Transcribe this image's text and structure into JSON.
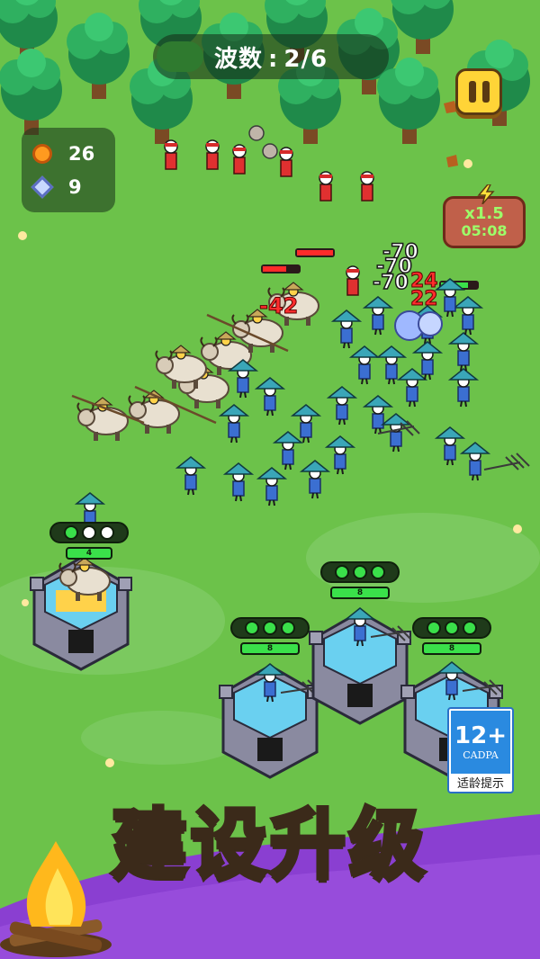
{
  "hud": {
    "wave_label": "波数",
    "wave_separator": ":",
    "wave_current": "2/6"
  },
  "resources": {
    "coins": "26",
    "gems": "9"
  },
  "speed": {
    "multiplier": "x1.5",
    "timer": "05:08"
  },
  "damage_numbers": [
    "-70",
    "-70",
    "-70",
    "-42",
    "24",
    "22"
  ],
  "towers": [
    {
      "name": "yak-tower",
      "level": "4",
      "stars": 1
    },
    {
      "name": "farmer-tower-left",
      "level": "8",
      "stars": 3
    },
    {
      "name": "farmer-tower-mid",
      "level": "8",
      "stars": 3
    },
    {
      "name": "farmer-tower-right",
      "level": "8",
      "stars": 3
    }
  ],
  "age_rating": {
    "number": "12+",
    "org": "CADPA",
    "caption": "适龄提示"
  },
  "caption": "建设升级",
  "colors": {
    "grass": "#6cc24a",
    "purple_banner": "#8a3fd1",
    "accent_yellow": "#ffd437",
    "hp_green": "#3ae04a"
  }
}
